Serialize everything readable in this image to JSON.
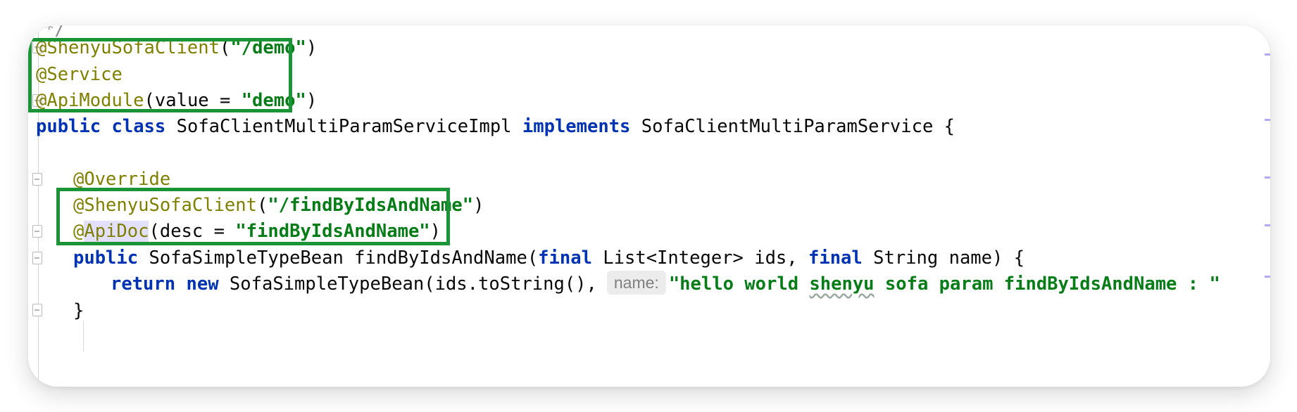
{
  "editor": {
    "comment_fragment": "*/",
    "lines": {
      "l1": {
        "annotation": "@ShenyuSofaClient",
        "open": "(",
        "str": "\"/demo\"",
        "close": ")"
      },
      "l2": {
        "annotation": "@Service"
      },
      "l3": {
        "annotation": "@ApiModule",
        "open": "(value = ",
        "str": "\"demo\"",
        "close": ")"
      },
      "l4": {
        "kw1": "public",
        "kw2": "class",
        "name": "SofaClientMultiParamServiceImpl",
        "kw3": "implements",
        "iface": "SofaClientMultiParamService {"
      },
      "l6": {
        "annotation": "@Override"
      },
      "l7": {
        "annotation": "@ShenyuSofaClient",
        "open": "(",
        "str": "\"/findByIdsAndName\"",
        "close": ")"
      },
      "l8": {
        "at": "@",
        "annotation_hl": "ApiDoc",
        "open": "(desc = ",
        "str": "\"findByIdsAndName\"",
        "close": ")"
      },
      "l9": {
        "kw1": "public",
        "type": "SofaSimpleTypeBean findByIdsAndName(",
        "kw2": "final",
        "p1": "List<Integer> ids, ",
        "kw3": "final",
        "p2": "String name) {"
      },
      "l10": {
        "kw1": "return",
        "kw2": "new",
        "call": "SofaSimpleTypeBean(ids.toString(),",
        "hint": "name:",
        "str_a": "\"hello world ",
        "str_wavy": "shenyu",
        "str_b": " sofa param findByIdsAndName : \""
      },
      "l11": {
        "close": "}"
      }
    },
    "highlight_color": "#1b9437"
  }
}
